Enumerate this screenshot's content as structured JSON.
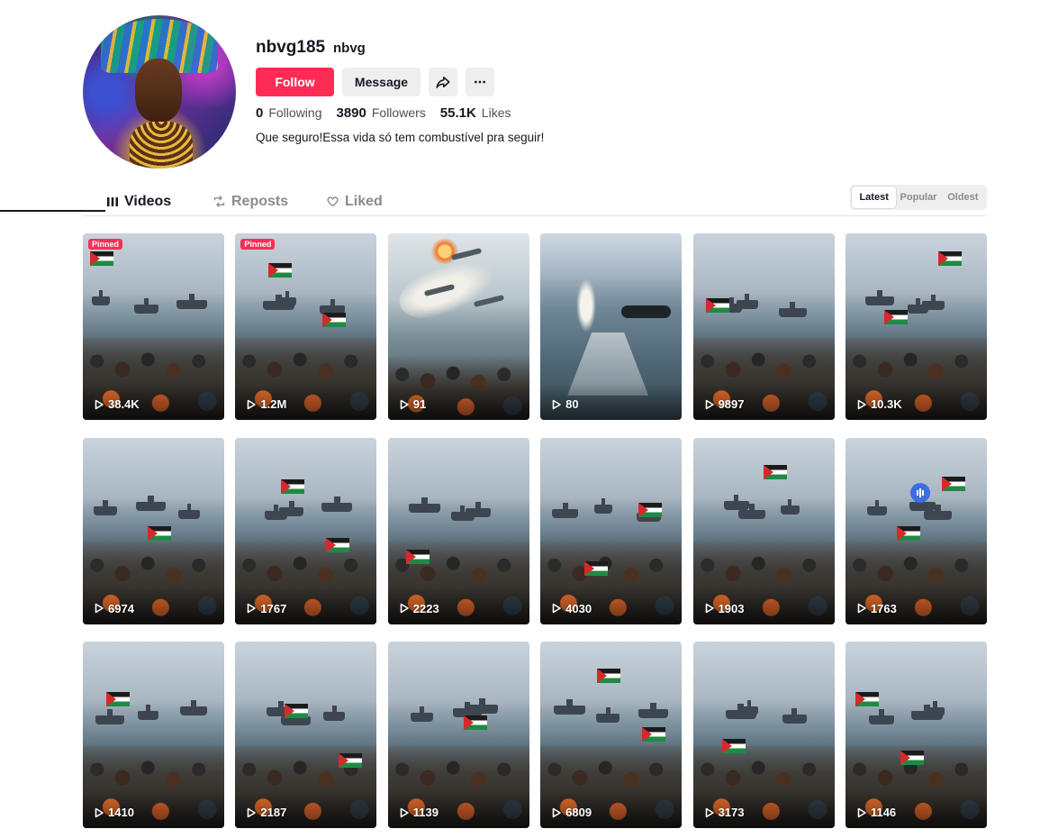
{
  "profile": {
    "username": "nbvg185",
    "nickname": "nbvg",
    "bio": "Que seguro!Essa vida só tem combustível pra seguir!",
    "avatar_icon": "avatar-image"
  },
  "actions": {
    "follow_label": "Follow",
    "message_label": "Message",
    "share_icon": "share-icon",
    "more_icon": "more-icon"
  },
  "stats": {
    "following_count": "0",
    "following_label": "Following",
    "followers_count": "3890",
    "followers_label": "Followers",
    "likes_count": "55.1K",
    "likes_label": "Likes"
  },
  "tabs": [
    {
      "label": "Videos",
      "icon": "grid-icon",
      "active": true
    },
    {
      "label": "Reposts",
      "icon": "repost-icon",
      "active": false
    },
    {
      "label": "Liked",
      "icon": "heart-icon",
      "active": false
    }
  ],
  "sort": {
    "options": [
      "Latest",
      "Popular",
      "Oldest"
    ],
    "selected": "Latest"
  },
  "videos": [
    {
      "views": "38.4K",
      "pinned": "Pinned",
      "style": "flotilla"
    },
    {
      "views": "1.2M",
      "pinned": "Pinned",
      "style": "flotilla-banner"
    },
    {
      "views": "91",
      "style": "jets"
    },
    {
      "views": "80",
      "style": "navy"
    },
    {
      "views": "9897",
      "style": "flotilla-banner"
    },
    {
      "views": "10.3K",
      "style": "flotilla-banner"
    },
    {
      "views": "6974",
      "style": "flotilla-banner"
    },
    {
      "views": "1767",
      "style": "flotilla-banner"
    },
    {
      "views": "2223",
      "style": "flotilla"
    },
    {
      "views": "4030",
      "style": "flotilla"
    },
    {
      "views": "1903",
      "style": "flotilla-banner"
    },
    {
      "views": "1763",
      "style": "flotilla-audio"
    },
    {
      "views": "1410",
      "style": "flotilla-banner"
    },
    {
      "views": "2187",
      "style": "flotilla-banner"
    },
    {
      "views": "1139",
      "style": "flotilla"
    },
    {
      "views": "6809",
      "style": "flotilla-banner"
    },
    {
      "views": "3173",
      "style": "flotilla-banner"
    },
    {
      "views": "1146",
      "style": "flotilla-banner"
    }
  ],
  "colors": {
    "accent": "#fe2c55",
    "text": "#161823",
    "muted": "#8a8b91"
  }
}
